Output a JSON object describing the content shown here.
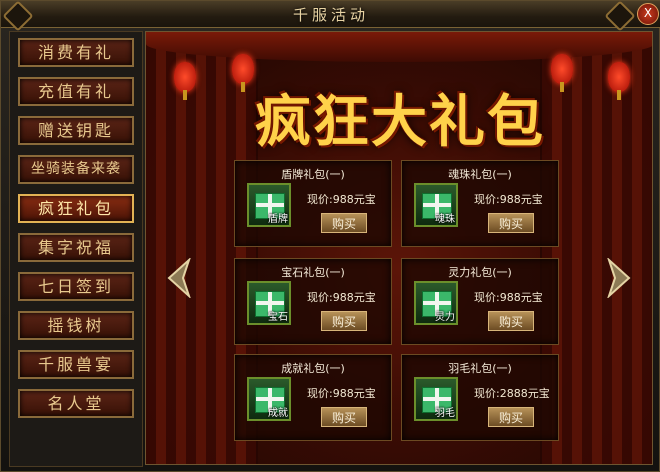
{
  "window": {
    "title": "千服活动",
    "close_label": "X"
  },
  "sidebar": {
    "items": [
      {
        "label": "消费有礼"
      },
      {
        "label": "充值有礼"
      },
      {
        "label": "赠送钥匙"
      },
      {
        "label": "坐骑装备来袭"
      },
      {
        "label": "疯狂礼包"
      },
      {
        "label": "集字祝福"
      },
      {
        "label": "七日签到"
      },
      {
        "label": "摇钱树"
      },
      {
        "label": "千服兽宴"
      },
      {
        "label": "名人堂"
      }
    ],
    "active_index": 4
  },
  "main": {
    "banner": "疯狂大礼包",
    "packages": [
      {
        "title": "盾牌礼包(一)",
        "item": "盾牌",
        "price": "现价:988元宝",
        "buy_label": "购买"
      },
      {
        "title": "魂珠礼包(一)",
        "item": "魂珠",
        "price": "现价:988元宝",
        "buy_label": "购买"
      },
      {
        "title": "宝石礼包(一)",
        "item": "宝石",
        "price": "现价:988元宝",
        "buy_label": "购买"
      },
      {
        "title": "灵力礼包(一)",
        "item": "灵力",
        "price": "现价:988元宝",
        "buy_label": "购买"
      },
      {
        "title": "成就礼包(一)",
        "item": "成就",
        "price": "现价:988元宝",
        "buy_label": "购买"
      },
      {
        "title": "羽毛礼包(一)",
        "item": "羽毛",
        "price": "现价:2888元宝",
        "buy_label": "购买"
      }
    ]
  },
  "colors": {
    "accent_gold": "#e2b254",
    "panel_red": "#5c1508",
    "gift_green": "#3bb86a"
  },
  "icons": [
    "close-icon",
    "gift-icon",
    "arrow-left-icon",
    "arrow-right-icon",
    "lantern-icon"
  ]
}
